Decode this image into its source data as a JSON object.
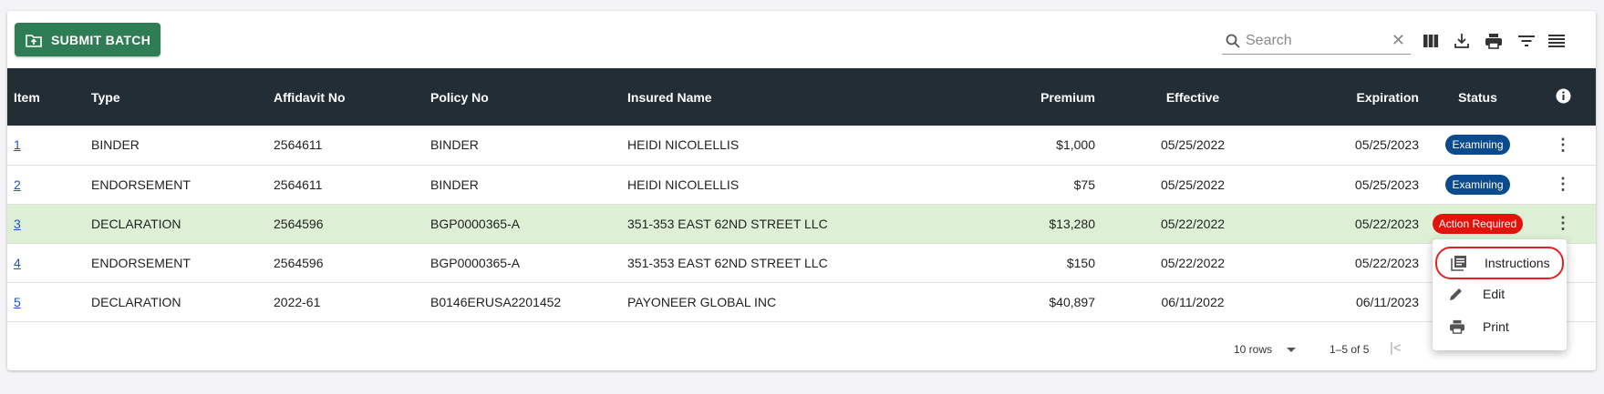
{
  "toolbar": {
    "submit_label": "SUBMIT BATCH",
    "search_placeholder": "Search",
    "icons": [
      "folder-upload-icon",
      "search-icon",
      "close-icon",
      "columns-icon",
      "download-icon",
      "print-icon",
      "filter-icon",
      "density-icon"
    ]
  },
  "table": {
    "headers": [
      "Item",
      "Type",
      "Affidavit No",
      "Policy No",
      "Insured Name",
      "Premium",
      "Effective",
      "Expiration",
      "Status"
    ],
    "rows": [
      {
        "item": "1",
        "type": "BINDER",
        "affidavit": "2564611",
        "policy": "BINDER",
        "insured": "HEIDI NICOLELLIS",
        "premium": "$1,000",
        "effective": "05/25/2022",
        "expiration": "05/25/2023",
        "status": "Examining"
      },
      {
        "item": "2",
        "type": "ENDORSEMENT",
        "affidavit": "2564611",
        "policy": "BINDER",
        "insured": "HEIDI NICOLELLIS",
        "premium": "$75",
        "effective": "05/25/2022",
        "expiration": "05/25/2023",
        "status": "Examining"
      },
      {
        "item": "3",
        "type": "DECLARATION",
        "affidavit": "2564596",
        "policy": "BGP0000365-A",
        "insured": "351-353 EAST 62ND STREET LLC",
        "premium": "$13,280",
        "effective": "05/22/2022",
        "expiration": "05/22/2023",
        "status": "Action Required"
      },
      {
        "item": "4",
        "type": "ENDORSEMENT",
        "affidavit": "2564596",
        "policy": "BGP0000365-A",
        "insured": "351-353 EAST 62ND STREET LLC",
        "premium": "$150",
        "effective": "05/22/2022",
        "expiration": "05/22/2023",
        "status": ""
      },
      {
        "item": "5",
        "type": "DECLARATION",
        "affidavit": "2022-61",
        "policy": "B0146ERUSA2201452",
        "insured": "PAYONEER GLOBAL INC",
        "premium": "$40,897",
        "effective": "06/11/2022",
        "expiration": "06/11/2023",
        "status": ""
      }
    ]
  },
  "status_colors": {
    "Examining": "#0b4a8c",
    "Action Required": "#e3120b"
  },
  "colors": {
    "header_bg": "#232d36",
    "accent": "#2e7d55",
    "highlight_row": "#ddf0d6"
  },
  "footer": {
    "rows_per_page": "10 rows",
    "range": "1–5 of 5"
  },
  "context_menu": {
    "items": [
      {
        "label": "Instructions",
        "icon": "instructions-icon"
      },
      {
        "label": "Edit",
        "icon": "pencil-icon"
      },
      {
        "label": "Print",
        "icon": "print-icon"
      }
    ]
  }
}
